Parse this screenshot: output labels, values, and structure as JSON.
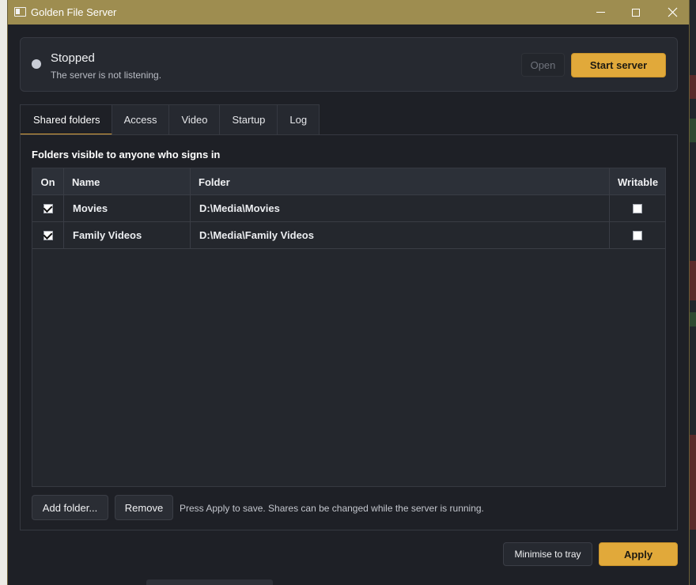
{
  "window": {
    "title": "Golden File Server"
  },
  "status": {
    "title": "Stopped",
    "subtitle": "The server is not listening.",
    "open_label": "Open",
    "start_label": "Start server"
  },
  "tabs": [
    {
      "label": "Shared folders",
      "active": true
    },
    {
      "label": "Access",
      "active": false
    },
    {
      "label": "Video",
      "active": false
    },
    {
      "label": "Startup",
      "active": false
    },
    {
      "label": "Log",
      "active": false
    }
  ],
  "panel": {
    "heading": "Folders visible to anyone who signs in",
    "columns": {
      "on": "On",
      "name": "Name",
      "folder": "Folder",
      "writable": "Writable"
    },
    "rows": [
      {
        "on": true,
        "name": "Movies",
        "folder": "D:\\Media\\Movies",
        "writable": false
      },
      {
        "on": true,
        "name": "Family Videos",
        "folder": "D:\\Media\\Family Videos",
        "writable": false
      }
    ],
    "add_label": "Add folder...",
    "remove_label": "Remove",
    "hint": "Press Apply to save. Shares can be changed while the server is running."
  },
  "footer": {
    "tray_label": "Minimise to tray",
    "apply_label": "Apply"
  },
  "colors": {
    "accent": "#e1a93a",
    "titlebar": "#9e8d50",
    "background": "#1e2026"
  }
}
